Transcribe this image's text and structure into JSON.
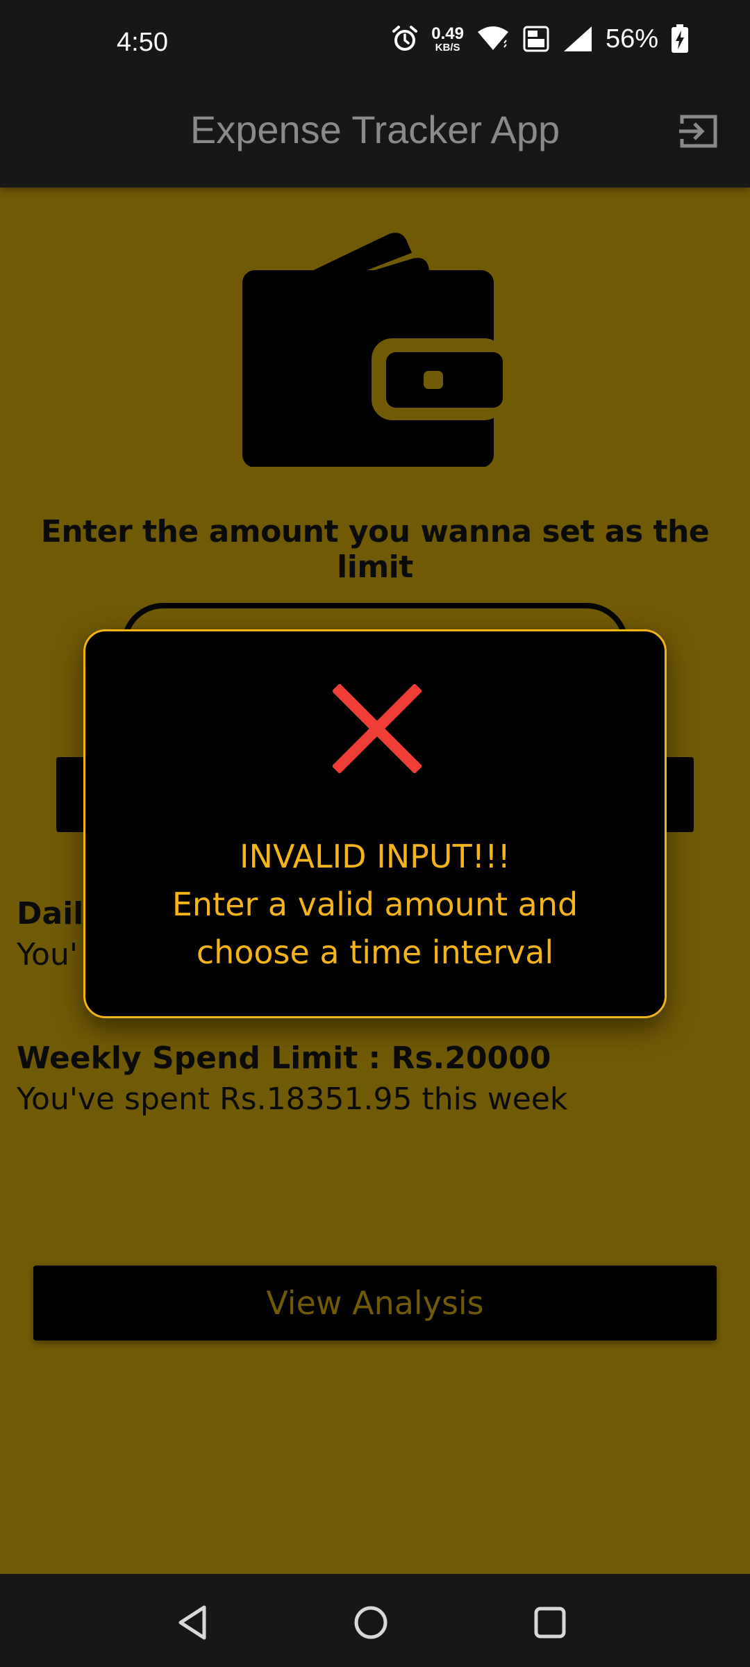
{
  "status_bar": {
    "time": "4:50",
    "net_speed_value": "0.49",
    "net_speed_unit": "KB/S",
    "battery": "56%",
    "icons": [
      "alarm-icon",
      "network-speed",
      "wifi-icon",
      "volte-icon",
      "signal-icon",
      "battery-charging-icon"
    ]
  },
  "app_bar": {
    "title": "Expense Tracker App",
    "action_icon": "logout-icon"
  },
  "main": {
    "prompt": "Enter the amount you wanna set as the limit",
    "daily": {
      "title": "Daily",
      "line": "You'"
    },
    "weekly": {
      "title": "Weekly Spend Limit : Rs.20000",
      "line": "You've spent Rs.18351.95 this week"
    },
    "analysis_button": "View Analysis"
  },
  "dialog": {
    "icon": "close-x-icon",
    "line1": "INVALID INPUT!!!",
    "line2": "Enter a valid amount and",
    "line3": "choose a time interval"
  },
  "nav_bar": {
    "icons": [
      "back-icon",
      "home-icon",
      "recents-icon"
    ]
  },
  "colors": {
    "background": "#715a06",
    "accent": "#f4b41a",
    "error": "#ef3e36",
    "bars": "#171717"
  }
}
